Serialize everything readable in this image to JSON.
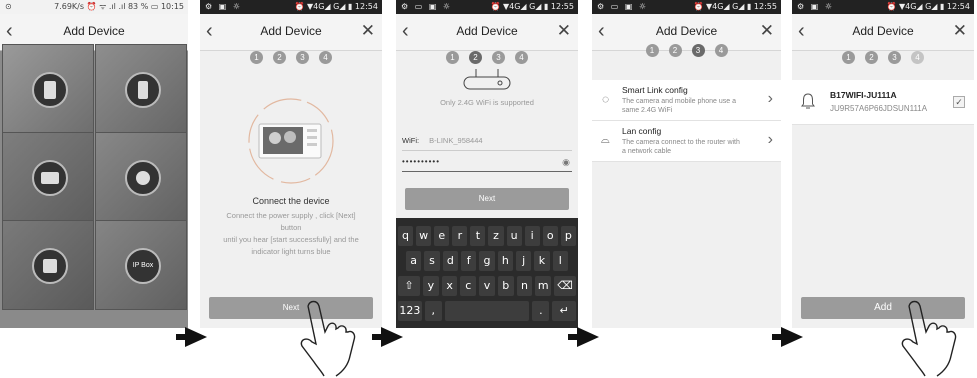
{
  "panel1": {
    "status_left": "⊙",
    "status_right": "7.69K/s ⏰ ᯤ .ıl .ıl 83 % ▭ 10:15",
    "title": "Add Device",
    "tile_label": "IP Box"
  },
  "panel2": {
    "status_icons": "⚙ ▣ ☼",
    "status_right": "⏰ ▼4G◢ G◢ ▮ 12:54",
    "title": "Add Device",
    "steps": [
      "1",
      "2",
      "3",
      "4"
    ],
    "heading": "Connect the device",
    "instructions": [
      "Connect the power supply , click [Next]",
      "button",
      "until you hear [start successfully] and the",
      "indicator light turns blue"
    ],
    "button": "Next"
  },
  "panel3": {
    "status_icons": "⚙ ▭ ▣ ☼",
    "status_right": "⏰ ▼4G◢ G◢ ▮ 12:55",
    "title": "Add Device",
    "steps": [
      "1",
      "2",
      "3",
      "4"
    ],
    "support_note": "Only 2.4G WiFi is supported",
    "wifi_label": "WiFi:",
    "wifi_value": "B-LINK_958444",
    "password_mask": "••••••••••",
    "button": "Next",
    "keys_row1": [
      "q",
      "w",
      "e",
      "r",
      "t",
      "z",
      "u",
      "i",
      "o",
      "p"
    ],
    "keys_row2": [
      "a",
      "s",
      "d",
      "f",
      "g",
      "h",
      "j",
      "k",
      "l"
    ],
    "keys_row3": [
      "y",
      "x",
      "c",
      "v",
      "b",
      "n",
      "m"
    ],
    "key_shift": "⇧",
    "key_backspace": "⌫",
    "key_num": "123",
    "key_comma": ",",
    "key_period": ".",
    "key_enter": "↵"
  },
  "panel4": {
    "status_icons": "⚙ ▭ ▣ ☼",
    "status_right": "⏰ ▼4G◢ G◢ ▮ 12:55",
    "title": "Add Device",
    "steps": [
      "1",
      "2",
      "3",
      "4"
    ],
    "options": [
      {
        "title": "Smart Link config",
        "desc1": "The camera and mobile phone use a",
        "desc2": "same 2.4G  WiFi"
      },
      {
        "title": "Lan config",
        "desc1": "The camera connect to the router with",
        "desc2": "a network  cable"
      }
    ]
  },
  "panel5": {
    "status_icons": "⚙ ▣ ☼",
    "status_right": "⏰ ▼4G◢ G◢ ▮ 12:54",
    "title": "Add Device",
    "steps": [
      "1",
      "2",
      "3",
      "4"
    ],
    "device_name": "B17WIFI-JU111A",
    "device_id": "JU9R57A6P66JDSUN111A",
    "button": "Add"
  }
}
